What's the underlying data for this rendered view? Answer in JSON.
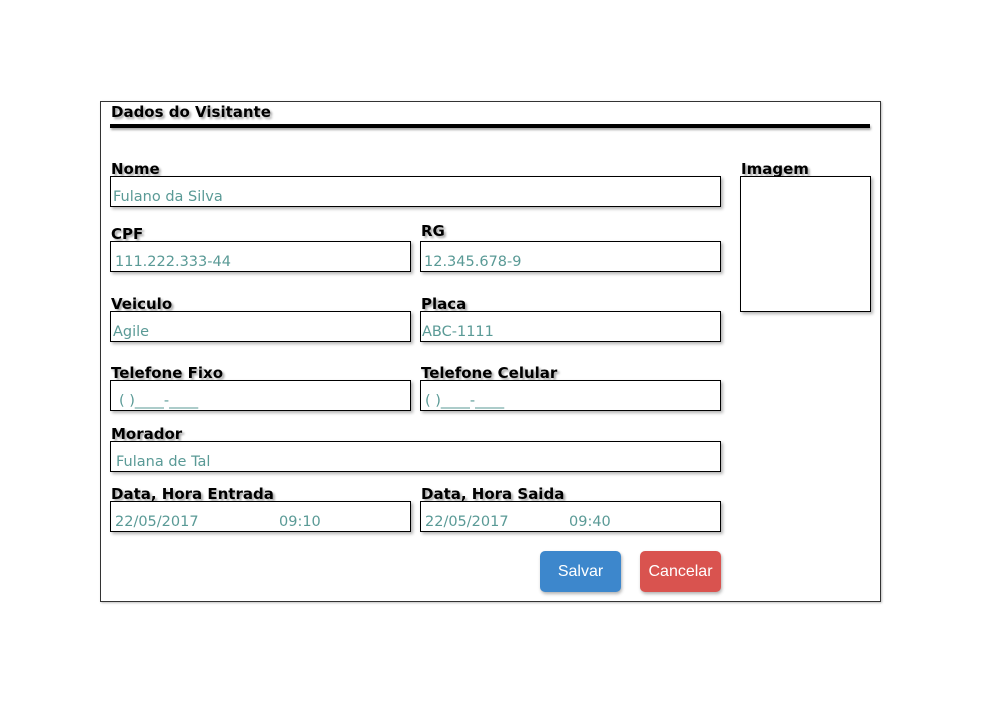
{
  "form": {
    "title": "Dados do Visitante",
    "image_label": "Imagem",
    "fields": {
      "nome": {
        "label": "Nome",
        "value": "Fulano da Silva"
      },
      "cpf": {
        "label": "CPF",
        "value": "111.222.333-44"
      },
      "rg": {
        "label": "RG",
        "value": "12.345.678-9"
      },
      "veiculo": {
        "label": "Veiculo",
        "value": "Agile"
      },
      "placa": {
        "label": "Placa",
        "value": "ABC-1111"
      },
      "telefone_fixo": {
        "label": "Telefone Fixo",
        "value": "( )____-____"
      },
      "telefone_celular": {
        "label": "Telefone Celular",
        "value": "( )____-____"
      },
      "morador": {
        "label": "Morador",
        "value": "Fulana de Tal"
      },
      "entrada": {
        "label": "Data, Hora Entrada",
        "date": "22/05/2017",
        "time": "09:10"
      },
      "saida": {
        "label": "Data, Hora Saida",
        "date": "22/05/2017",
        "time": "09:40"
      }
    },
    "buttons": {
      "save": "Salvar",
      "cancel": "Cancelar"
    }
  },
  "colors": {
    "save_button": "#3d87cc",
    "cancel_button": "#d9534f",
    "value_text": "#5a9a96"
  }
}
